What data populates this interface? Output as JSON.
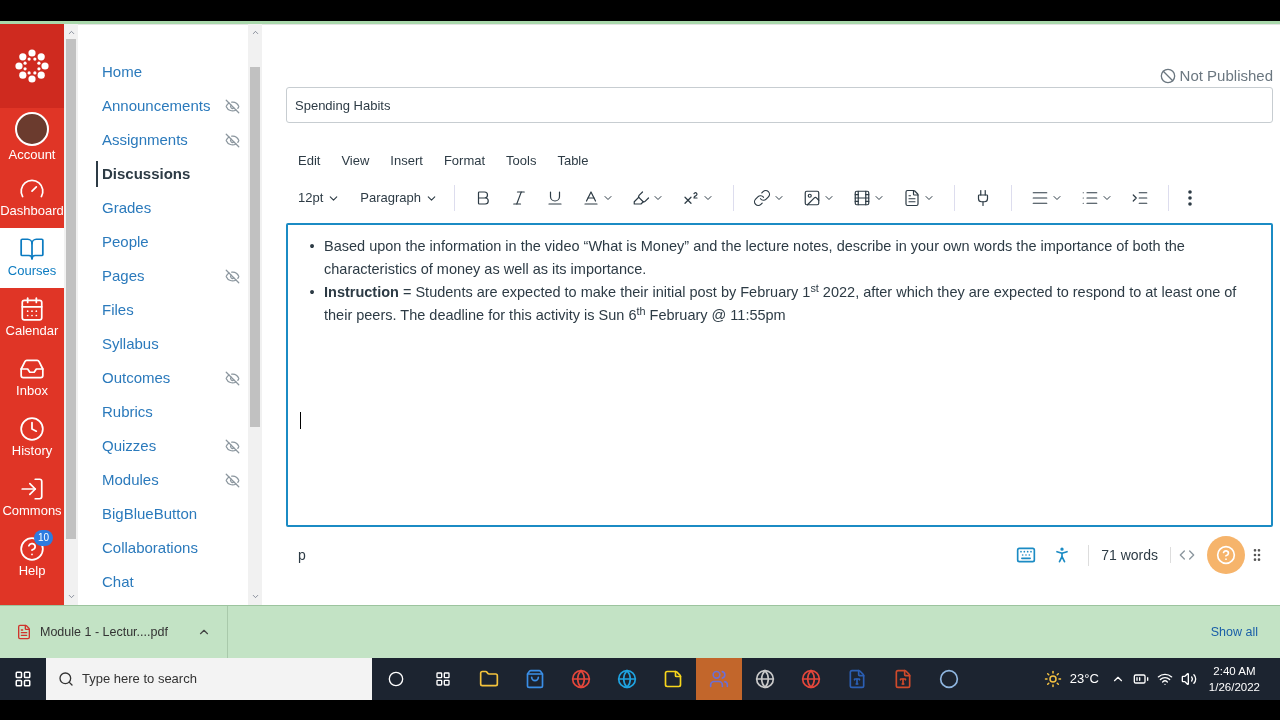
{
  "global_nav": [
    {
      "label": "Account",
      "selected": false
    },
    {
      "label": "Dashboard",
      "selected": false
    },
    {
      "label": "Courses",
      "selected": true
    },
    {
      "label": "Calendar",
      "selected": false
    },
    {
      "label": "Inbox",
      "selected": false
    },
    {
      "label": "History",
      "selected": false
    },
    {
      "label": "Commons",
      "selected": false
    },
    {
      "label": "Help",
      "selected": false,
      "badge": "10"
    }
  ],
  "course_nav": [
    {
      "label": "Home",
      "selected": false,
      "hidden": false
    },
    {
      "label": "Announcements",
      "selected": false,
      "hidden": true
    },
    {
      "label": "Assignments",
      "selected": false,
      "hidden": true
    },
    {
      "label": "Discussions",
      "selected": true,
      "hidden": false
    },
    {
      "label": "Grades",
      "selected": false,
      "hidden": false
    },
    {
      "label": "People",
      "selected": false,
      "hidden": false
    },
    {
      "label": "Pages",
      "selected": false,
      "hidden": true
    },
    {
      "label": "Files",
      "selected": false,
      "hidden": false
    },
    {
      "label": "Syllabus",
      "selected": false,
      "hidden": false
    },
    {
      "label": "Outcomes",
      "selected": false,
      "hidden": true
    },
    {
      "label": "Rubrics",
      "selected": false,
      "hidden": false
    },
    {
      "label": "Quizzes",
      "selected": false,
      "hidden": true
    },
    {
      "label": "Modules",
      "selected": false,
      "hidden": true
    },
    {
      "label": "BigBlueButton",
      "selected": false,
      "hidden": false
    },
    {
      "label": "Collaborations",
      "selected": false,
      "hidden": false
    },
    {
      "label": "Chat",
      "selected": false,
      "hidden": false
    }
  ],
  "publish_status": "Not Published",
  "title_field": {
    "value": "Spending Habits"
  },
  "editor": {
    "menus": [
      "Edit",
      "View",
      "Insert",
      "Format",
      "Tools",
      "Table"
    ],
    "font_size": "12pt",
    "block_format": "Paragraph",
    "bullet": "•",
    "content": [
      "Based upon the information in the video “What is Money” and the lecture notes, describe in your own words the importance of both the characteristics of money as well as its importance.",
      "**Instruction** = Students are expected to make their initial post by February 1$^{st}$ 2022, after which they are expected to respond to at least one of their peers. The deadline for this activity is Sun 6$^{th}$ February @ 11:55pm"
    ],
    "path": "p",
    "word_count": "71 words"
  },
  "downloads": {
    "file": "Module 1 - Lectur....pdf",
    "show_all": "Show all"
  },
  "taskbar": {
    "search_placeholder": "Type here to search",
    "weather": "23°C",
    "time": "2:40 AM",
    "date": "1/26/2022"
  }
}
